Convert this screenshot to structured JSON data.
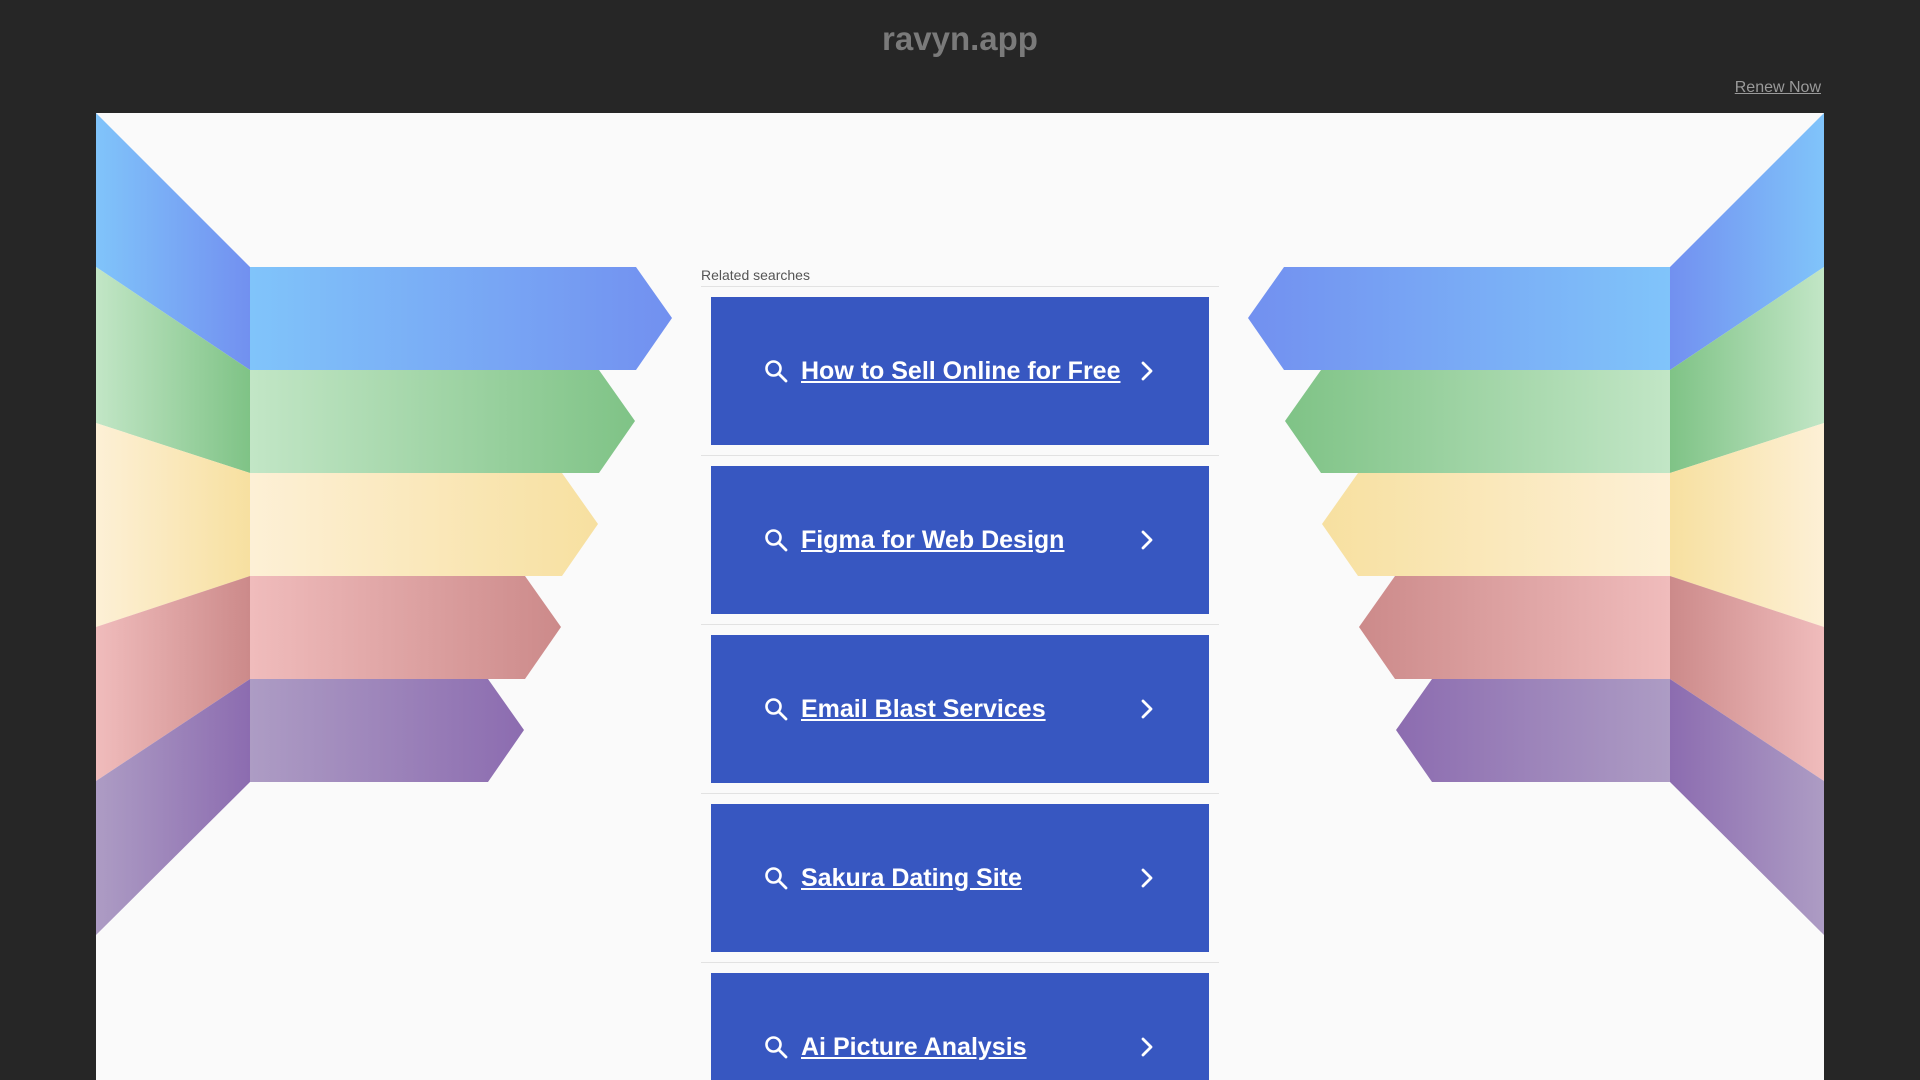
{
  "header": {
    "domain": "ravyn.app",
    "renew_label": "Renew Now"
  },
  "related": {
    "label": "Related searches",
    "items": [
      {
        "label": "How to Sell Online for Free"
      },
      {
        "label": "Figma for Web Design"
      },
      {
        "label": "Email Blast Services"
      },
      {
        "label": "Sakura Dating Site"
      },
      {
        "label": "Ai Picture Analysis"
      }
    ]
  },
  "colors": {
    "background": "#262626",
    "panel": "#fafafa",
    "button": "#3757c1",
    "text_on_button": "#ffffff",
    "ribbon_blue": "#7ab8f5",
    "ribbon_green": "#8ccc94",
    "ribbon_yellow": "#fae6ae",
    "ribbon_red": "#e0a6a6",
    "ribbon_purple": "#9e86bc"
  },
  "icons": {
    "search": "search-icon",
    "chevron": "chevron-right-icon"
  }
}
